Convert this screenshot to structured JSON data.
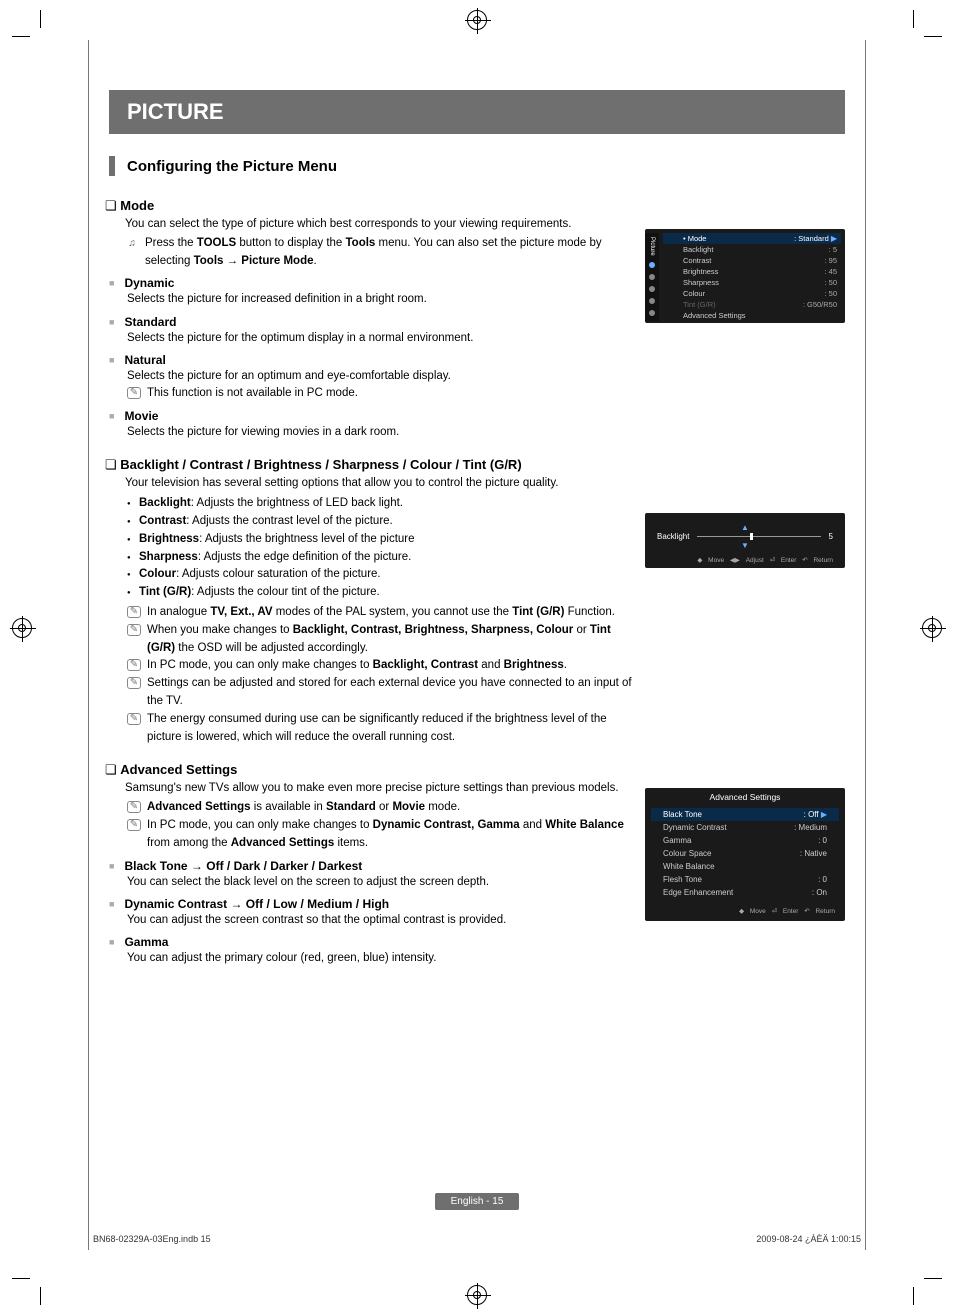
{
  "title": "PICTURE",
  "heading": "Configuring the Picture Menu",
  "mode": {
    "title": "Mode",
    "intro": "You can select the type of picture which best corresponds to your viewing requirements.",
    "tools_pre": "Press the ",
    "tools_b1": "TOOLS",
    "tools_mid": " button to display the ",
    "tools_b2": "Tools",
    "tools_mid2": " menu. You can also set the picture mode by selecting ",
    "tools_b3": "Tools → Picture Mode",
    "tools_post": ".",
    "dynamic_h": "Dynamic",
    "dynamic_t": "Selects the picture for increased definition in a bright room.",
    "standard_h": "Standard",
    "standard_t": "Selects the picture for the optimum display in a normal environment.",
    "natural_h": "Natural",
    "natural_t": "Selects the picture for an optimum and eye-comfortable display.",
    "natural_note": "This function is not available in PC mode.",
    "movie_h": "Movie",
    "movie_t": "Selects the picture for viewing movies in a dark room."
  },
  "bc": {
    "title": "Backlight / Contrast / Brightness / Sharpness / Colour / Tint (G/R)",
    "intro": "Your television has several setting options that allow you to control the picture quality.",
    "items": [
      {
        "b": "Backlight",
        "t": ": Adjusts the brightness of LED back light."
      },
      {
        "b": "Contrast",
        "t": ": Adjusts the contrast level of the picture."
      },
      {
        "b": "Brightness",
        "t": ": Adjusts the brightness level of the picture"
      },
      {
        "b": "Sharpness",
        "t": ": Adjusts the edge definition of the picture."
      },
      {
        "b": "Colour",
        "t": ": Adjusts colour saturation of the picture."
      },
      {
        "b": "Tint (G/R)",
        "t": ": Adjusts the colour tint of the picture."
      }
    ],
    "n1_pre": "In analogue ",
    "n1_b": "TV, Ext., AV",
    "n1_mid": " modes of the PAL system, you cannot use the ",
    "n1_b2": "Tint (G/R)",
    "n1_post": " Function.",
    "n2_pre": "When you make changes to ",
    "n2_b": "Backlight, Contrast, Brightness, Sharpness, Colour",
    "n2_mid": " or ",
    "n2_b2": "Tint (G/R)",
    "n2_post": " the OSD will be adjusted accordingly.",
    "n3_pre": "In PC mode, you can only make changes to ",
    "n3_b": "Backlight, Contrast",
    "n3_mid": " and ",
    "n3_b2": "Brightness",
    "n3_post": ".",
    "n4": "Settings can be adjusted and stored for each external device you have connected to an input of the TV.",
    "n5": "The energy consumed during use can be significantly reduced if the brightness level of the picture is lowered, which will reduce the overall running cost."
  },
  "adv": {
    "title": "Advanced Settings",
    "intro": "Samsung's new TVs allow you to make even more precise picture settings than previous models.",
    "n1_b": "Advanced Settings",
    "n1_mid": " is available in ",
    "n1_b2": "Standard",
    "n1_mid2": " or ",
    "n1_b3": "Movie",
    "n1_post": " mode.",
    "n2_pre": "In PC mode, you can only make changes to ",
    "n2_b": "Dynamic Contrast, Gamma",
    "n2_mid": " and ",
    "n2_b2": "White Balance",
    "n2_mid2": " from among the ",
    "n2_b3": "Advanced Settings",
    "n2_post": " items.",
    "bt_h": "Black Tone → Off / Dark / Darker / Darkest",
    "bt_t": "You can select the black level on the screen to adjust the screen depth.",
    "dc_h": "Dynamic Contrast → Off / Low / Medium / High",
    "dc_t": "You can adjust the screen contrast so that the optimal contrast is provided.",
    "g_h": "Gamma",
    "g_t": "You can adjust the primary colour (red, green, blue) intensity."
  },
  "osd1": {
    "sidebar_label": "Picture",
    "mode_label": "Mode",
    "mode_val": "Standard",
    "rows": [
      {
        "l": "Backlight",
        "v": ": 5"
      },
      {
        "l": "Contrast",
        "v": ": 95"
      },
      {
        "l": "Brightness",
        "v": ": 45"
      },
      {
        "l": "Sharpness",
        "v": ": 50"
      },
      {
        "l": "Colour",
        "v": ": 50"
      },
      {
        "l": "Tint (G/R)",
        "v": ": G50/R50"
      },
      {
        "l": "Advanced Settings",
        "v": ""
      }
    ]
  },
  "osd2": {
    "label": "Backlight",
    "val": "5",
    "f_move": "Move",
    "f_adjust": "Adjust",
    "f_enter": "Enter",
    "f_return": "Return"
  },
  "osd3": {
    "title": "Advanced Settings",
    "rows": [
      {
        "l": "Black Tone",
        "v": ": Off",
        "sel": true
      },
      {
        "l": "Dynamic Contrast",
        "v": ": Medium"
      },
      {
        "l": "Gamma",
        "v": ": 0"
      },
      {
        "l": "Colour Space",
        "v": ": Native"
      },
      {
        "l": "White Balance",
        "v": ""
      },
      {
        "l": "Flesh Tone",
        "v": ": 0"
      },
      {
        "l": "Edge Enhancement",
        "v": ": On"
      }
    ],
    "f_move": "Move",
    "f_enter": "Enter",
    "f_return": "Return"
  },
  "page_footer": "English - 15",
  "doc_footer_left": "BN68-02329A-03Eng.indb   15",
  "doc_footer_right": "2009-08-24    ¿ÀÈÄ 1:00:15"
}
